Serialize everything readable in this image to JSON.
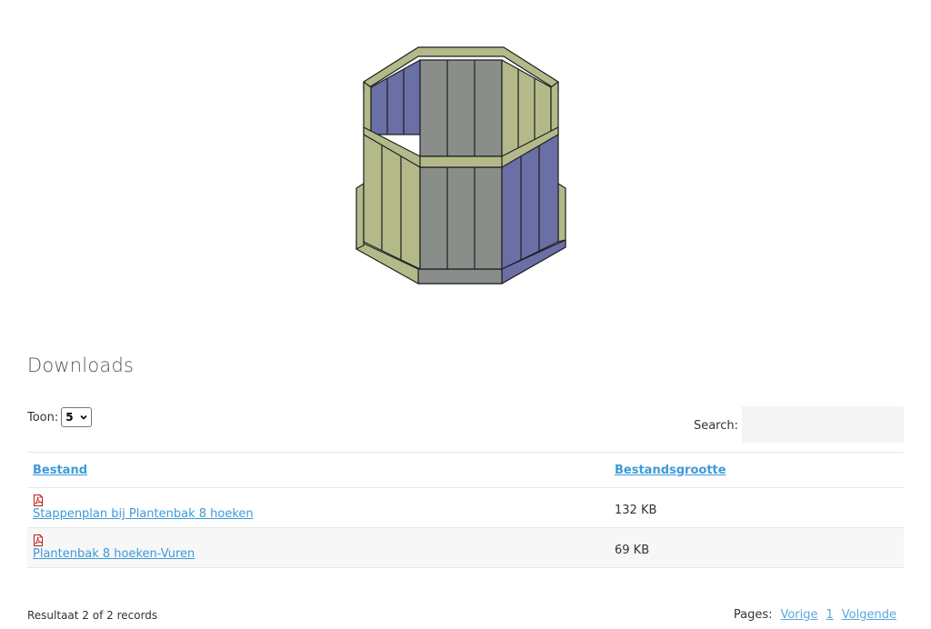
{
  "section": {
    "title": "Downloads"
  },
  "toon": {
    "label": "Toon:",
    "selected": "5"
  },
  "search": {
    "label": "Search:",
    "value": ""
  },
  "table": {
    "headers": [
      "Bestand",
      "Bestandsgrootte"
    ],
    "rows": [
      {
        "name": "Stappenplan bij Plantenbak 8 hoeken",
        "size": "132 KB",
        "icon": "pdf-icon"
      },
      {
        "name": "Plantenbak 8 hoeken-Vuren",
        "size": "69 KB",
        "icon": "pdf-icon"
      }
    ]
  },
  "footer": {
    "result": "Resultaat 2 of 2 records",
    "pages_label": "Pages:",
    "prev": "Vorige",
    "page": "1",
    "next": "Volgende"
  },
  "colors": {
    "link": "#3d9ad9",
    "wood_light": "#b4b98a",
    "wood_blue": "#6a6fa6",
    "wood_grey": "#8a8e8a"
  }
}
